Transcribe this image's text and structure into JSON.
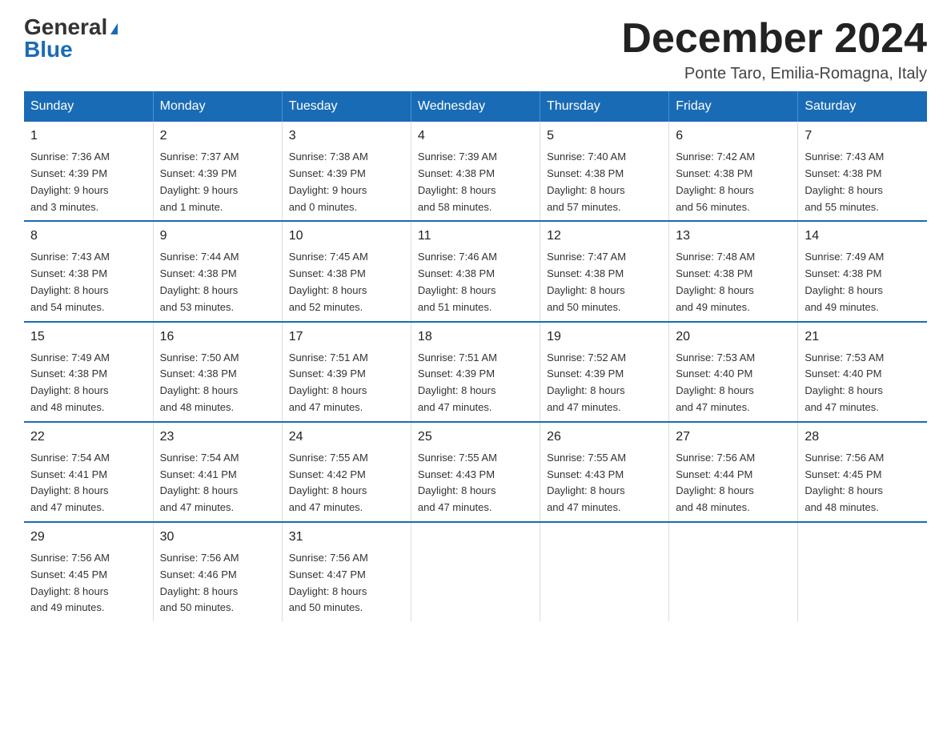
{
  "logo": {
    "general": "General",
    "blue": "Blue"
  },
  "header": {
    "month": "December 2024",
    "location": "Ponte Taro, Emilia-Romagna, Italy"
  },
  "days_of_week": [
    "Sunday",
    "Monday",
    "Tuesday",
    "Wednesday",
    "Thursday",
    "Friday",
    "Saturday"
  ],
  "weeks": [
    [
      {
        "day": "1",
        "sunrise": "7:36 AM",
        "sunset": "4:39 PM",
        "daylight": "9 hours and 3 minutes."
      },
      {
        "day": "2",
        "sunrise": "7:37 AM",
        "sunset": "4:39 PM",
        "daylight": "9 hours and 1 minute."
      },
      {
        "day": "3",
        "sunrise": "7:38 AM",
        "sunset": "4:39 PM",
        "daylight": "9 hours and 0 minutes."
      },
      {
        "day": "4",
        "sunrise": "7:39 AM",
        "sunset": "4:38 PM",
        "daylight": "8 hours and 58 minutes."
      },
      {
        "day": "5",
        "sunrise": "7:40 AM",
        "sunset": "4:38 PM",
        "daylight": "8 hours and 57 minutes."
      },
      {
        "day": "6",
        "sunrise": "7:42 AM",
        "sunset": "4:38 PM",
        "daylight": "8 hours and 56 minutes."
      },
      {
        "day": "7",
        "sunrise": "7:43 AM",
        "sunset": "4:38 PM",
        "daylight": "8 hours and 55 minutes."
      }
    ],
    [
      {
        "day": "8",
        "sunrise": "7:43 AM",
        "sunset": "4:38 PM",
        "daylight": "8 hours and 54 minutes."
      },
      {
        "day": "9",
        "sunrise": "7:44 AM",
        "sunset": "4:38 PM",
        "daylight": "8 hours and 53 minutes."
      },
      {
        "day": "10",
        "sunrise": "7:45 AM",
        "sunset": "4:38 PM",
        "daylight": "8 hours and 52 minutes."
      },
      {
        "day": "11",
        "sunrise": "7:46 AM",
        "sunset": "4:38 PM",
        "daylight": "8 hours and 51 minutes."
      },
      {
        "day": "12",
        "sunrise": "7:47 AM",
        "sunset": "4:38 PM",
        "daylight": "8 hours and 50 minutes."
      },
      {
        "day": "13",
        "sunrise": "7:48 AM",
        "sunset": "4:38 PM",
        "daylight": "8 hours and 49 minutes."
      },
      {
        "day": "14",
        "sunrise": "7:49 AM",
        "sunset": "4:38 PM",
        "daylight": "8 hours and 49 minutes."
      }
    ],
    [
      {
        "day": "15",
        "sunrise": "7:49 AM",
        "sunset": "4:38 PM",
        "daylight": "8 hours and 48 minutes."
      },
      {
        "day": "16",
        "sunrise": "7:50 AM",
        "sunset": "4:38 PM",
        "daylight": "8 hours and 48 minutes."
      },
      {
        "day": "17",
        "sunrise": "7:51 AM",
        "sunset": "4:39 PM",
        "daylight": "8 hours and 47 minutes."
      },
      {
        "day": "18",
        "sunrise": "7:51 AM",
        "sunset": "4:39 PM",
        "daylight": "8 hours and 47 minutes."
      },
      {
        "day": "19",
        "sunrise": "7:52 AM",
        "sunset": "4:39 PM",
        "daylight": "8 hours and 47 minutes."
      },
      {
        "day": "20",
        "sunrise": "7:53 AM",
        "sunset": "4:40 PM",
        "daylight": "8 hours and 47 minutes."
      },
      {
        "day": "21",
        "sunrise": "7:53 AM",
        "sunset": "4:40 PM",
        "daylight": "8 hours and 47 minutes."
      }
    ],
    [
      {
        "day": "22",
        "sunrise": "7:54 AM",
        "sunset": "4:41 PM",
        "daylight": "8 hours and 47 minutes."
      },
      {
        "day": "23",
        "sunrise": "7:54 AM",
        "sunset": "4:41 PM",
        "daylight": "8 hours and 47 minutes."
      },
      {
        "day": "24",
        "sunrise": "7:55 AM",
        "sunset": "4:42 PM",
        "daylight": "8 hours and 47 minutes."
      },
      {
        "day": "25",
        "sunrise": "7:55 AM",
        "sunset": "4:43 PM",
        "daylight": "8 hours and 47 minutes."
      },
      {
        "day": "26",
        "sunrise": "7:55 AM",
        "sunset": "4:43 PM",
        "daylight": "8 hours and 47 minutes."
      },
      {
        "day": "27",
        "sunrise": "7:56 AM",
        "sunset": "4:44 PM",
        "daylight": "8 hours and 48 minutes."
      },
      {
        "day": "28",
        "sunrise": "7:56 AM",
        "sunset": "4:45 PM",
        "daylight": "8 hours and 48 minutes."
      }
    ],
    [
      {
        "day": "29",
        "sunrise": "7:56 AM",
        "sunset": "4:45 PM",
        "daylight": "8 hours and 49 minutes."
      },
      {
        "day": "30",
        "sunrise": "7:56 AM",
        "sunset": "4:46 PM",
        "daylight": "8 hours and 50 minutes."
      },
      {
        "day": "31",
        "sunrise": "7:56 AM",
        "sunset": "4:47 PM",
        "daylight": "8 hours and 50 minutes."
      },
      null,
      null,
      null,
      null
    ]
  ],
  "labels": {
    "sunrise": "Sunrise:",
    "sunset": "Sunset:",
    "daylight": "Daylight:"
  }
}
